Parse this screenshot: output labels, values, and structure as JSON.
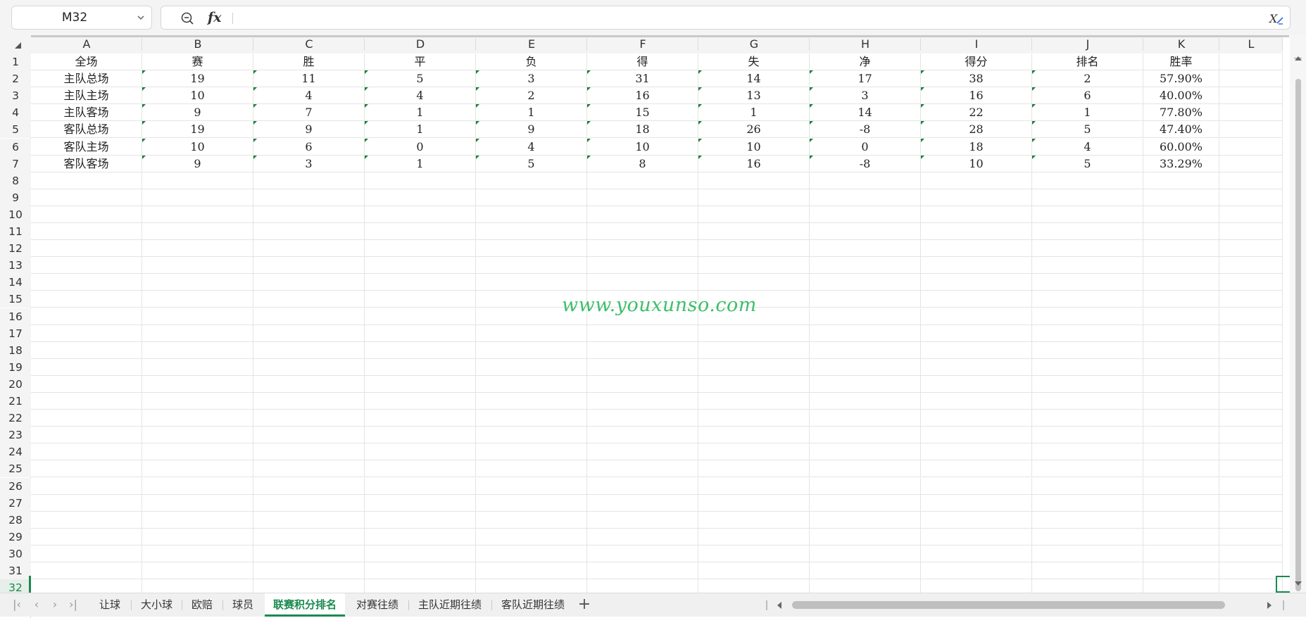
{
  "name_box": {
    "ref": "M32"
  },
  "formula_bar": {
    "fx_label": "fx",
    "value": ""
  },
  "columns": [
    "A",
    "B",
    "C",
    "D",
    "E",
    "F",
    "G",
    "H",
    "I",
    "J",
    "K",
    "L"
  ],
  "rows": [
    "1",
    "2",
    "3",
    "4",
    "5",
    "6",
    "7",
    "8",
    "9",
    "10",
    "11",
    "12",
    "13",
    "14",
    "15",
    "16",
    "17",
    "18",
    "19",
    "20",
    "21",
    "22",
    "23",
    "24",
    "25",
    "26",
    "27",
    "28",
    "29",
    "30",
    "31",
    "32"
  ],
  "active_row": "32",
  "table": {
    "header": [
      "全场",
      "赛",
      "胜",
      "平",
      "负",
      "得",
      "失",
      "净",
      "得分",
      "排名",
      "胜率"
    ],
    "data": [
      [
        "主队总场",
        "19",
        "11",
        "5",
        "3",
        "31",
        "14",
        "17",
        "38",
        "2",
        "57.90%"
      ],
      [
        "主队主场",
        "10",
        "4",
        "4",
        "2",
        "16",
        "13",
        "3",
        "16",
        "6",
        "40.00%"
      ],
      [
        "主队客场",
        "9",
        "7",
        "1",
        "1",
        "15",
        "1",
        "14",
        "22",
        "1",
        "77.80%"
      ],
      [
        "客队总场",
        "19",
        "9",
        "1",
        "9",
        "18",
        "26",
        "-8",
        "28",
        "5",
        "47.40%"
      ],
      [
        "客队主场",
        "10",
        "6",
        "0",
        "4",
        "10",
        "10",
        "0",
        "18",
        "4",
        "60.00%"
      ],
      [
        "客队客场",
        "9",
        "3",
        "1",
        "5",
        "8",
        "16",
        "-8",
        "10",
        "5",
        "33.29%"
      ]
    ]
  },
  "watermark": "www.youxunso.com",
  "sheet_tabs": [
    "让球",
    "大小球",
    "欧赔",
    "球员",
    "联赛积分排名",
    "对赛往绩",
    "主队近期往绩",
    "客队近期往绩"
  ],
  "active_sheet_index": 4,
  "colors": {
    "accent": "#1a8a4f",
    "watermark": "#3fbf6a",
    "error_marker": "#1a7f3c"
  }
}
